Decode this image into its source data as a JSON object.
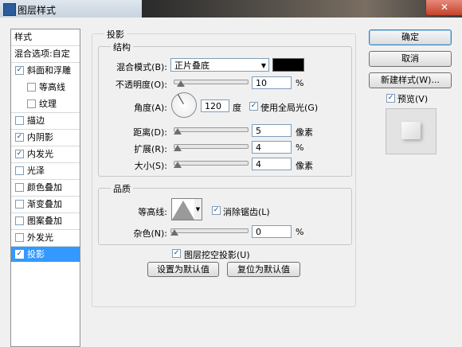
{
  "window": {
    "title": "图层样式",
    "close_glyph": "✕"
  },
  "sidebar": {
    "header": "样式",
    "blend_options": "混合选项:自定",
    "items": [
      {
        "label": "斜面和浮雕",
        "checked": true
      },
      {
        "label": "等高线",
        "checked": false
      },
      {
        "label": "纹理",
        "checked": false
      },
      {
        "label": "描边",
        "checked": false
      },
      {
        "label": "内阴影",
        "checked": true
      },
      {
        "label": "内发光",
        "checked": true
      },
      {
        "label": "光泽",
        "checked": false
      },
      {
        "label": "颜色叠加",
        "checked": false
      },
      {
        "label": "渐变叠加",
        "checked": false
      },
      {
        "label": "图案叠加",
        "checked": false
      },
      {
        "label": "外发光",
        "checked": false
      },
      {
        "label": "投影",
        "checked": true,
        "selected": true
      }
    ]
  },
  "panel": {
    "section_title": "投影",
    "structure": {
      "title": "结构",
      "blend_mode_label": "混合模式(B):",
      "blend_mode_value": "正片叠底",
      "blend_color": "#000000",
      "opacity_label": "不透明度(O):",
      "opacity_value": "10",
      "opacity_unit": "%",
      "angle_label": "角度(A):",
      "angle_value": "120",
      "angle_unit": "度",
      "global_light_label": "使用全局光(G)",
      "distance_label": "距离(D):",
      "distance_value": "5",
      "distance_unit": "像素",
      "spread_label": "扩展(R):",
      "spread_value": "4",
      "spread_unit": "%",
      "size_label": "大小(S):",
      "size_value": "4",
      "size_unit": "像素"
    },
    "quality": {
      "title": "品质",
      "contour_label": "等高线:",
      "antialias_label": "消除锯齿(L)",
      "noise_label": "杂色(N):",
      "noise_value": "0",
      "noise_unit": "%"
    },
    "knockout_label": "图层挖空投影(U)",
    "make_default": "设置为默认值",
    "reset_default": "复位为默认值"
  },
  "right": {
    "ok": "确定",
    "cancel": "取消",
    "new_style": "新建样式(W)...",
    "preview_label": "预览(V)"
  },
  "colors": {
    "selection": "#3399ff",
    "swatch": "#000000"
  }
}
